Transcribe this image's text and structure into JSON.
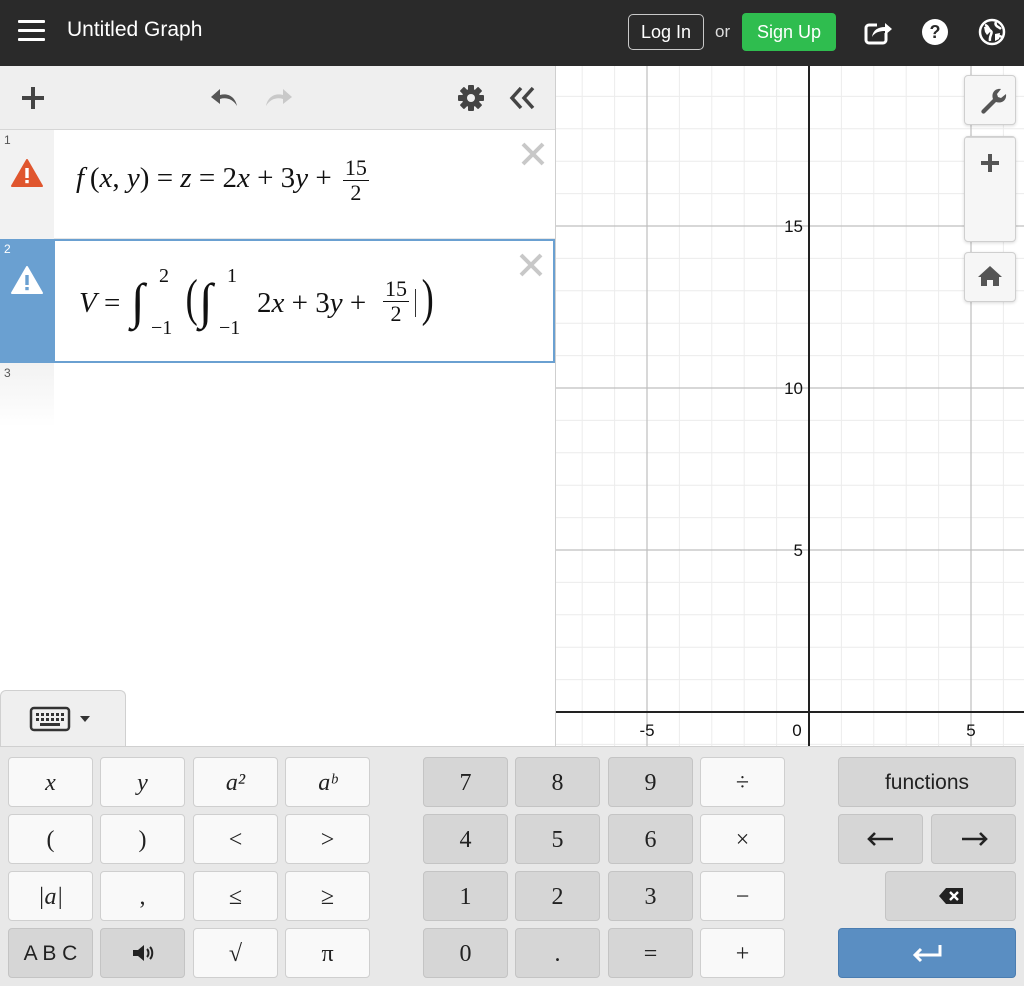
{
  "header": {
    "title": "Untitled Graph",
    "login_label": "Log In",
    "or_text": "or",
    "signup_label": "Sign Up",
    "icons": [
      "menu-icon",
      "share-icon",
      "help-icon",
      "globe-icon"
    ]
  },
  "expressions": [
    {
      "number": "1",
      "status": "warning",
      "latex_text": "f(x,y) = z = 2x + 3y + 15/2"
    },
    {
      "number": "2",
      "status": "warning",
      "active": true,
      "latex_text": "V = ∫_{-1}^{2} ( ∫_{-1}^{1} 2x + 3y + 15/2 )",
      "int1_upper": "2",
      "int1_lower": "−1",
      "int2_upper": "1",
      "int2_lower": "−1"
    },
    {
      "number": "3"
    }
  ],
  "graph": {
    "x_ticks": [
      "-5",
      "0",
      "5"
    ],
    "y_ticks": [
      "15",
      "10",
      "5"
    ]
  },
  "keyboard": {
    "left": [
      [
        "x",
        "y",
        "a²",
        "aᵇ"
      ],
      [
        "(",
        ")",
        "<",
        ">"
      ],
      [
        "|a|",
        ",",
        "≤",
        "≥"
      ],
      [
        "A B C",
        "speaker",
        "√",
        "π"
      ]
    ],
    "middle": [
      [
        "7",
        "8",
        "9",
        "÷"
      ],
      [
        "4",
        "5",
        "6",
        "×"
      ],
      [
        "1",
        "2",
        "3",
        "−"
      ],
      [
        "0",
        ".",
        "=",
        "+"
      ]
    ],
    "functions_label": "functions"
  },
  "colors": {
    "topbar": "#2a2a2a",
    "signup": "#2fbd4f",
    "active_row": "#6aa0d1",
    "warning": "#e0562e",
    "enter_key": "#5a8ec2"
  }
}
